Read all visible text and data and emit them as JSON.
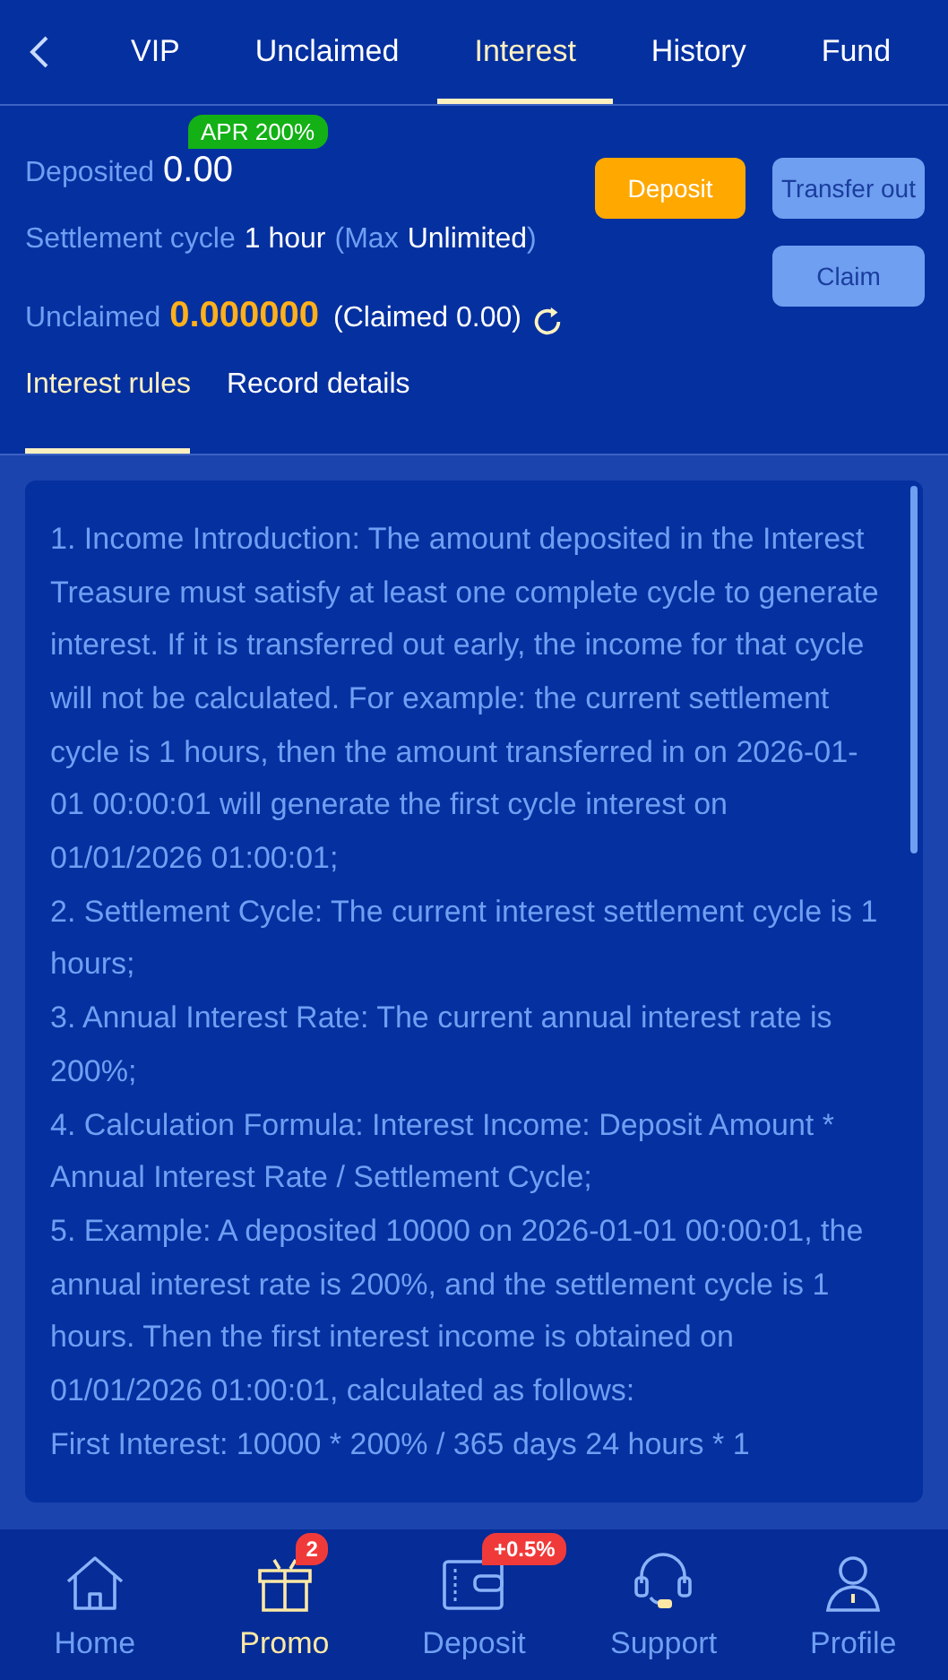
{
  "tabs": [
    {
      "label": "VIP",
      "selected": false
    },
    {
      "label": "Unclaimed",
      "selected": false
    },
    {
      "label": "Interest",
      "selected": true
    },
    {
      "label": "History",
      "selected": false
    },
    {
      "label": "Fund",
      "selected": false
    }
  ],
  "summary": {
    "apr_badge": "APR 200%",
    "deposited_label": "Deposited",
    "deposited_value": "0.00",
    "settlement_label": "Settlement cycle",
    "settlement_value": "1 hour",
    "max_open": "(Max",
    "max_value": "Unlimited",
    "max_close": ")",
    "unclaimed_label": "Unclaimed",
    "unclaimed_value": "0.000000",
    "claimed": "(Claimed 0.00)"
  },
  "buttons": {
    "deposit": "Deposit",
    "transfer_out": "Transfer out",
    "claim": "Claim"
  },
  "sub_tabs": [
    {
      "label": "Interest rules",
      "selected": true
    },
    {
      "label": "Record details",
      "selected": false
    }
  ],
  "rules": [
    "1. Income Introduction: The amount deposited in the Interest Treasure must satisfy at least one complete cycle to generate interest. If it is transferred out early, the income for that cycle will not be calculated. For example: the current settlement cycle is 1 hours, then the amount transferred in on 2026-01-01 00:00:01 will generate the first cycle interest on 01/01/2026 01:00:01;",
    "2. Settlement Cycle: The current interest settlement cycle is 1 hours;",
    "3. Annual Interest Rate: The current annual interest rate is 200%;",
    "4. Calculation Formula: Interest Income: Deposit Amount * Annual Interest Rate / Settlement Cycle;",
    "5. Example: A deposited 10000 on 2026-01-01 00:00:01, the annual interest rate is 200%, and the settlement cycle is 1 hours. Then the first interest income is obtained on 01/01/2026 01:00:01, calculated as follows:",
    "First Interest: 10000 * 200% / 365 days 24 hours * 1"
  ],
  "nav": [
    {
      "label": "Home",
      "kind": "home",
      "selected": false
    },
    {
      "label": "Promo",
      "kind": "gift",
      "selected": true,
      "badge": "2"
    },
    {
      "label": "Deposit",
      "kind": "wallet",
      "selected": false,
      "badge": "+0.5%"
    },
    {
      "label": "Support",
      "kind": "headset",
      "selected": false
    },
    {
      "label": "Profile",
      "kind": "person",
      "selected": false
    }
  ]
}
